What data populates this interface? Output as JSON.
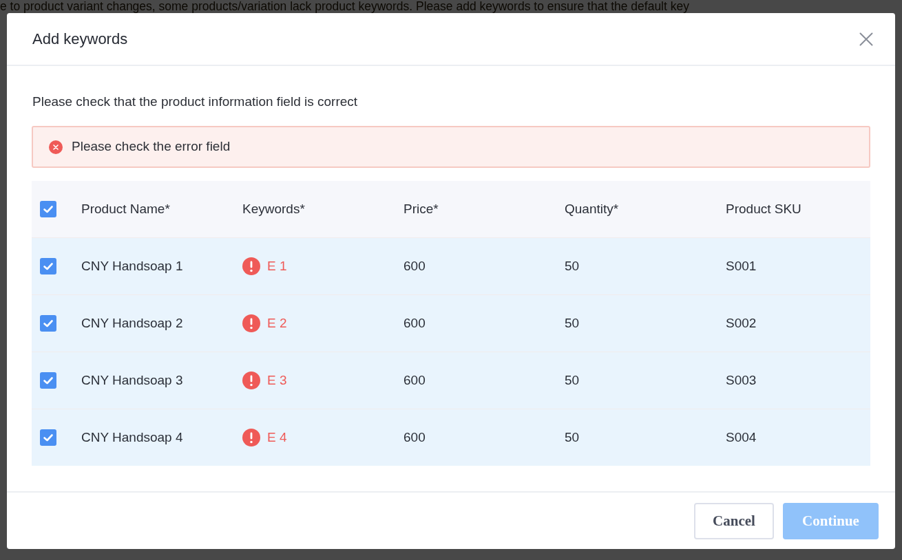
{
  "background": {
    "notice": "e to product variant changes, some products/variation lack product keywords. Please add keywords to ensure that the default key"
  },
  "dialog": {
    "title": "Add keywords",
    "intro": "Please check that the product information field is correct",
    "alert": {
      "kind": "error",
      "message": "Please check the error field"
    },
    "table": {
      "select_all": {
        "checked": true
      },
      "columns": [
        "Product Name*",
        "Keywords*",
        "Price*",
        "Quantity*",
        "Product SKU"
      ],
      "rows": [
        {
          "checked": true,
          "product_name": "CNY Handsoap 1",
          "keywords": {
            "text": "E 1",
            "error": true
          },
          "price": "600",
          "quantity": "50",
          "sku": "S001"
        },
        {
          "checked": true,
          "product_name": "CNY Handsoap 2",
          "keywords": {
            "text": "E 2",
            "error": true
          },
          "price": "600",
          "quantity": "50",
          "sku": "S002"
        },
        {
          "checked": true,
          "product_name": "CNY Handsoap 3",
          "keywords": {
            "text": "E 3",
            "error": true
          },
          "price": "600",
          "quantity": "50",
          "sku": "S003"
        },
        {
          "checked": true,
          "product_name": "CNY Handsoap 4",
          "keywords": {
            "text": "E 4",
            "error": true
          },
          "price": "600",
          "quantity": "50",
          "sku": "S004"
        }
      ]
    },
    "buttons": [
      {
        "label": "Cancel",
        "kind": "secondary",
        "disabled": false
      },
      {
        "label": "Continue",
        "kind": "primary",
        "disabled": true
      }
    ]
  }
}
